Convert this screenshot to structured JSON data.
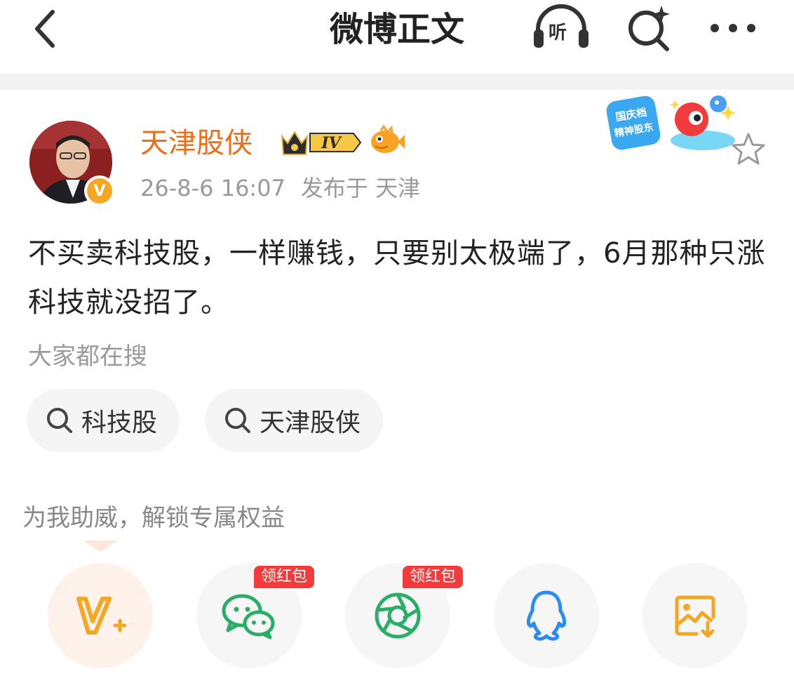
{
  "header": {
    "title": "微博正文",
    "listen_label": "听"
  },
  "author": {
    "name": "天津股侠",
    "level_badge": "IV",
    "timestamp": "26-8-6 16:07",
    "location": "发布于 天津",
    "verified_mark": "V"
  },
  "promo": {
    "line1": "国庆档",
    "line2": "精神股东"
  },
  "post": {
    "text": "不买卖科技股，一样赚钱，只要别太极端了，6月那种只涨科技就没招了。"
  },
  "search": {
    "label": "大家都在搜",
    "chips": [
      "科技股",
      "天津股侠"
    ]
  },
  "support": {
    "label": "为我助威，解锁专属权益"
  },
  "share": {
    "redpack_label_1": "领红包",
    "redpack_label_2": "领红包"
  },
  "colors": {
    "accent_orange": "#f06d15",
    "red_badge": "#f43a3a",
    "wechat_green": "#2aae67",
    "qq_blue": "#2b8cf0",
    "save_orange": "#f5a623"
  }
}
